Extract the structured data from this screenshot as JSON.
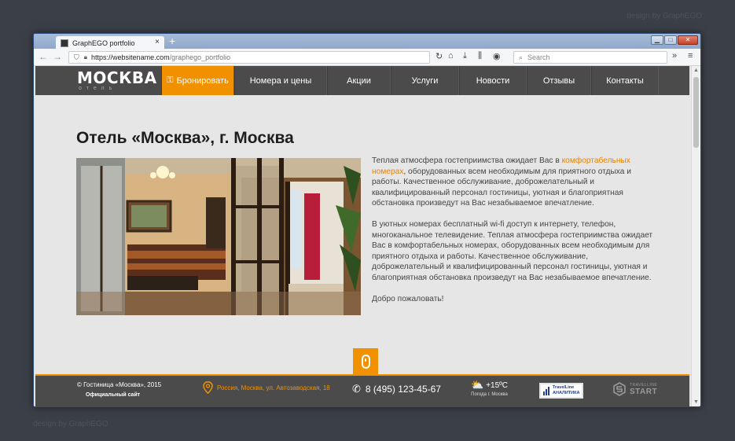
{
  "credits": {
    "top": "design by GraphEGO",
    "bottom": "design by GraphEGO"
  },
  "browser": {
    "tab_title": "GraphEGO portfolio",
    "tab_close": "×",
    "new_tab": "+",
    "window_controls": {
      "minimize": "▁",
      "maximize": "□",
      "close": "✕"
    },
    "url_host": "https://websitename.com",
    "url_path": "/graphego_portfolio",
    "search_placeholder": "Search",
    "icons": [
      "back-icon",
      "forward-icon",
      "shield-icon",
      "lock-icon",
      "reload-icon",
      "home-icon",
      "download-icon",
      "library-icon",
      "account-icon",
      "search-icon",
      "overflow-icon",
      "menu-icon"
    ]
  },
  "site": {
    "logo": {
      "name": "МОСКВА",
      "sub": "отель"
    },
    "menu": [
      {
        "label": "Бронировать",
        "active": true
      },
      {
        "label": "Номера и цены",
        "active": false
      },
      {
        "label": "Акции",
        "active": false
      },
      {
        "label": "Услуги",
        "active": false
      },
      {
        "label": "Новости",
        "active": false
      },
      {
        "label": "Отзывы",
        "active": false
      },
      {
        "label": "Контакты",
        "active": false
      }
    ],
    "title": "Отель «Москва», г. Москва",
    "article": {
      "p1_before": "Теплая атмосфера гостеприимства ожидает Вас в ",
      "p1_link": "комфортабельных номерах",
      "p1_after": ", оборудованных всем необходимым для приятного отдыха и работы. Качественное обслуживание, доброжелательный и квалифицированный персонал гостиницы, уютная и благоприятная обстановка произведут на Вас незабываемое впечатление.",
      "p2": "В уютных номерах бесплатный wi-fi доступ к интернету, телефон, многоканальное телевидение. Теплая атмосфера гостеприимства ожидает Вас в комфортабельных номерах, оборудованных всем необходимым для приятного отдыха и работы. Качественное обслуживание, доброжелательный и квалифицированный персонал гостиницы, уютная и благоприятная обстановка произведут на Вас незабываемое впечатление.",
      "p3": "Добро пожаловать!"
    },
    "footer": {
      "copyright": "© Гостиница «Москва», 2015",
      "official": "Официальный сайт",
      "address": "Россия, Москва, ул. Автозаводская, 18",
      "phone": "8 (495) 123-45-67",
      "temperature": "+15ºC",
      "weather_city": "Погода г. Москва",
      "tl_analytics": {
        "line1": "TravelLine",
        "line2": "АНАЛИТИКА"
      },
      "tl_start": {
        "line1": "TRAVELLINE",
        "line2": "START"
      }
    }
  },
  "colors": {
    "accent": "#f29100",
    "nav_bg": "#4b4b4b",
    "page_bg": "#e6e6e6",
    "link": "#e88300"
  }
}
